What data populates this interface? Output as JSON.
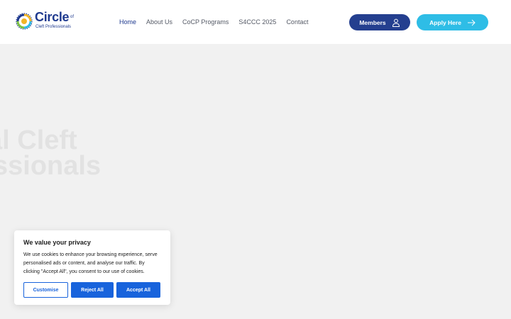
{
  "header": {
    "logo": {
      "word": "Circle",
      "of": "of",
      "subtitle": "Cleft Professionals"
    },
    "nav": [
      {
        "label": "Home",
        "active": true
      },
      {
        "label": "About Us",
        "active": false
      },
      {
        "label": "CoCP Programs",
        "active": false
      },
      {
        "label": "S4CCC 2025",
        "active": false
      },
      {
        "label": "Contact",
        "active": false
      }
    ],
    "members_label": "Members",
    "apply_label": "Apply Here"
  },
  "hero": {
    "title_line1": "al Cleft",
    "title_line2": "ssionals"
  },
  "cookie": {
    "title": "We value your privacy",
    "text": "We use cookies to enhance your browsing experience, serve personalised ads or content, and analyse our traffic. By clicking \"Accept All\", you consent to our use of cookies.",
    "customise_label": "Customise",
    "reject_label": "Reject All",
    "accept_label": "Accept All"
  },
  "colors": {
    "brand_navy": "#243f8f",
    "brand_cyan": "#2ebde6",
    "cookie_blue": "#1863dc"
  },
  "icons": {
    "members": "user-icon",
    "apply": "arrow-right-icon"
  }
}
